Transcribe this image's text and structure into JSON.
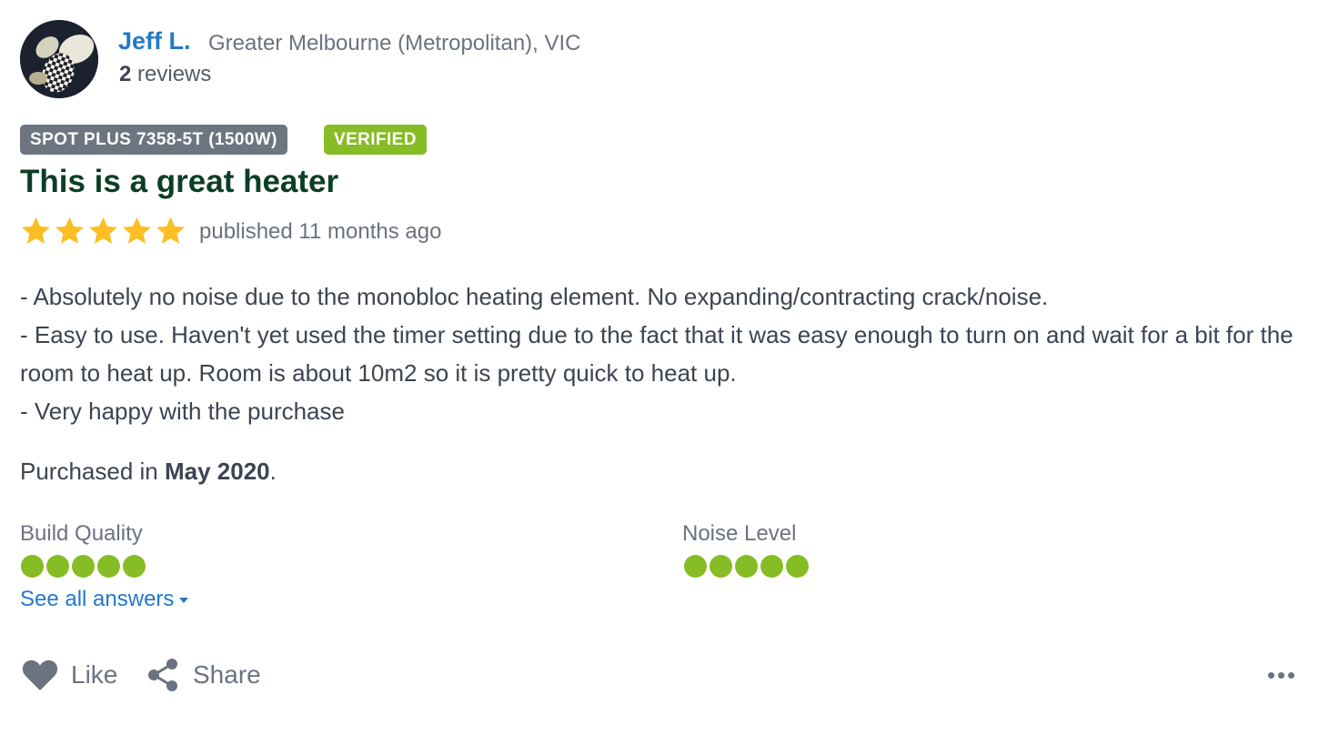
{
  "author": {
    "name": "Jeff L.",
    "location": "Greater Melbourne (Metropolitan), VIC",
    "review_count": "2",
    "review_count_suffix": " reviews",
    "avatar": "avatar-photo"
  },
  "badges": {
    "product": "SPOT PLUS 7358-5T (1500W)",
    "verified": "VERIFIED"
  },
  "review": {
    "title": "This is a great heater",
    "rating": 5,
    "rating_max": 5,
    "published": "published 11 months ago",
    "body": [
      "- Absolutely no noise due to the monobloc heating element. No expanding/contracting crack/noise.",
      "- Easy to use. Haven't yet used the timer setting due to the fact that it was easy enough to turn on and wait for a bit for the room to heat up. Room is about 10m2 so it is pretty quick to heat up.",
      "- Very happy with the purchase"
    ],
    "purchased_prefix": "Purchased in ",
    "purchased_date": "May 2020",
    "purchased_suffix": "."
  },
  "ratings": [
    {
      "label": "Build Quality",
      "value": 5,
      "max": 5
    },
    {
      "label": "Noise Level",
      "value": 5,
      "max": 5
    }
  ],
  "see_all": "See all answers",
  "actions": {
    "like": "Like",
    "share": "Share",
    "more_icon": "more-options-icon"
  },
  "colors": {
    "link": "#2379c9",
    "title": "#0c3d27",
    "star": "#fbbf24",
    "dot": "#86bc24",
    "badge_gray": "#6c7580",
    "badge_green": "#86bc24"
  }
}
